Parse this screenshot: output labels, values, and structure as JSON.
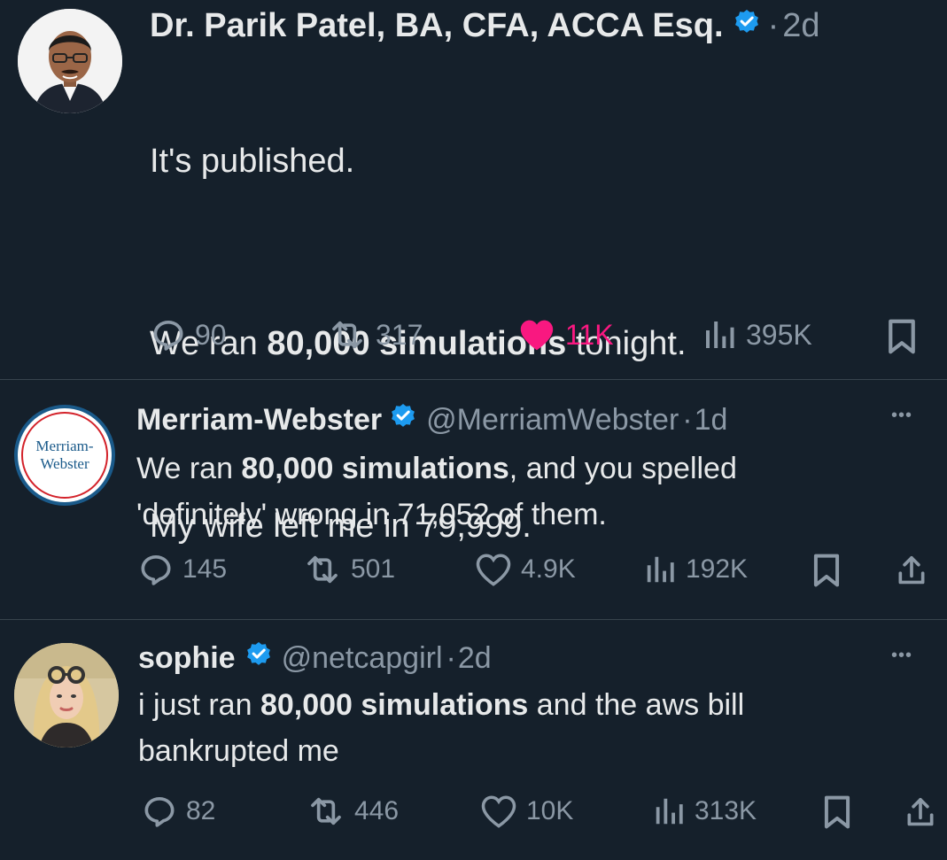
{
  "tweets": [
    {
      "author_name": "Dr. Parik Patel, BA, CFA, ACCA Esq.",
      "handle": "",
      "separator": "·",
      "time": "2d",
      "text_line1": "It's published.",
      "text_line2_pre": "We ran ",
      "text_line2_bold": "80,000 simulations",
      "text_line2_post": " tonight.",
      "text_line3": "My wife left me in 79,999.",
      "replies": "90",
      "reposts": "317",
      "likes": "11K",
      "views": "395K",
      "liked": true
    },
    {
      "author_name": "Merriam-Webster",
      "handle": "@MerriamWebster",
      "separator": "·",
      "time": "1d",
      "avatar_text_1": "Merriam-",
      "avatar_text_2": "Webster",
      "text_pre": "We ran ",
      "text_bold": "80,000 simulations",
      "text_post": ", and you spelled\n'definitely' wrong in 71,052 of them.",
      "replies": "145",
      "reposts": "501",
      "likes": "4.9K",
      "views": "192K",
      "more": "•••"
    },
    {
      "author_name": "sophie",
      "handle": "@netcapgirl",
      "separator": "·",
      "time": "2d",
      "text_pre": "i just ran ",
      "text_bold": "80,000 simulations",
      "text_post": " and the aws bill\nbankrupted me",
      "replies": "82",
      "reposts": "446",
      "likes": "10K",
      "views": "313K",
      "more": "•••"
    }
  ],
  "colors": {
    "background": "#15202b",
    "text": "#e7e9ea",
    "muted": "#8b98a5",
    "verified": "#1d9bf0",
    "like_active": "#f91880",
    "divider": "#38444d"
  },
  "icons": [
    "reply-icon",
    "repost-icon",
    "like-icon",
    "views-icon",
    "bookmark-icon",
    "share-icon",
    "verified-badge-icon",
    "more-icon"
  ]
}
